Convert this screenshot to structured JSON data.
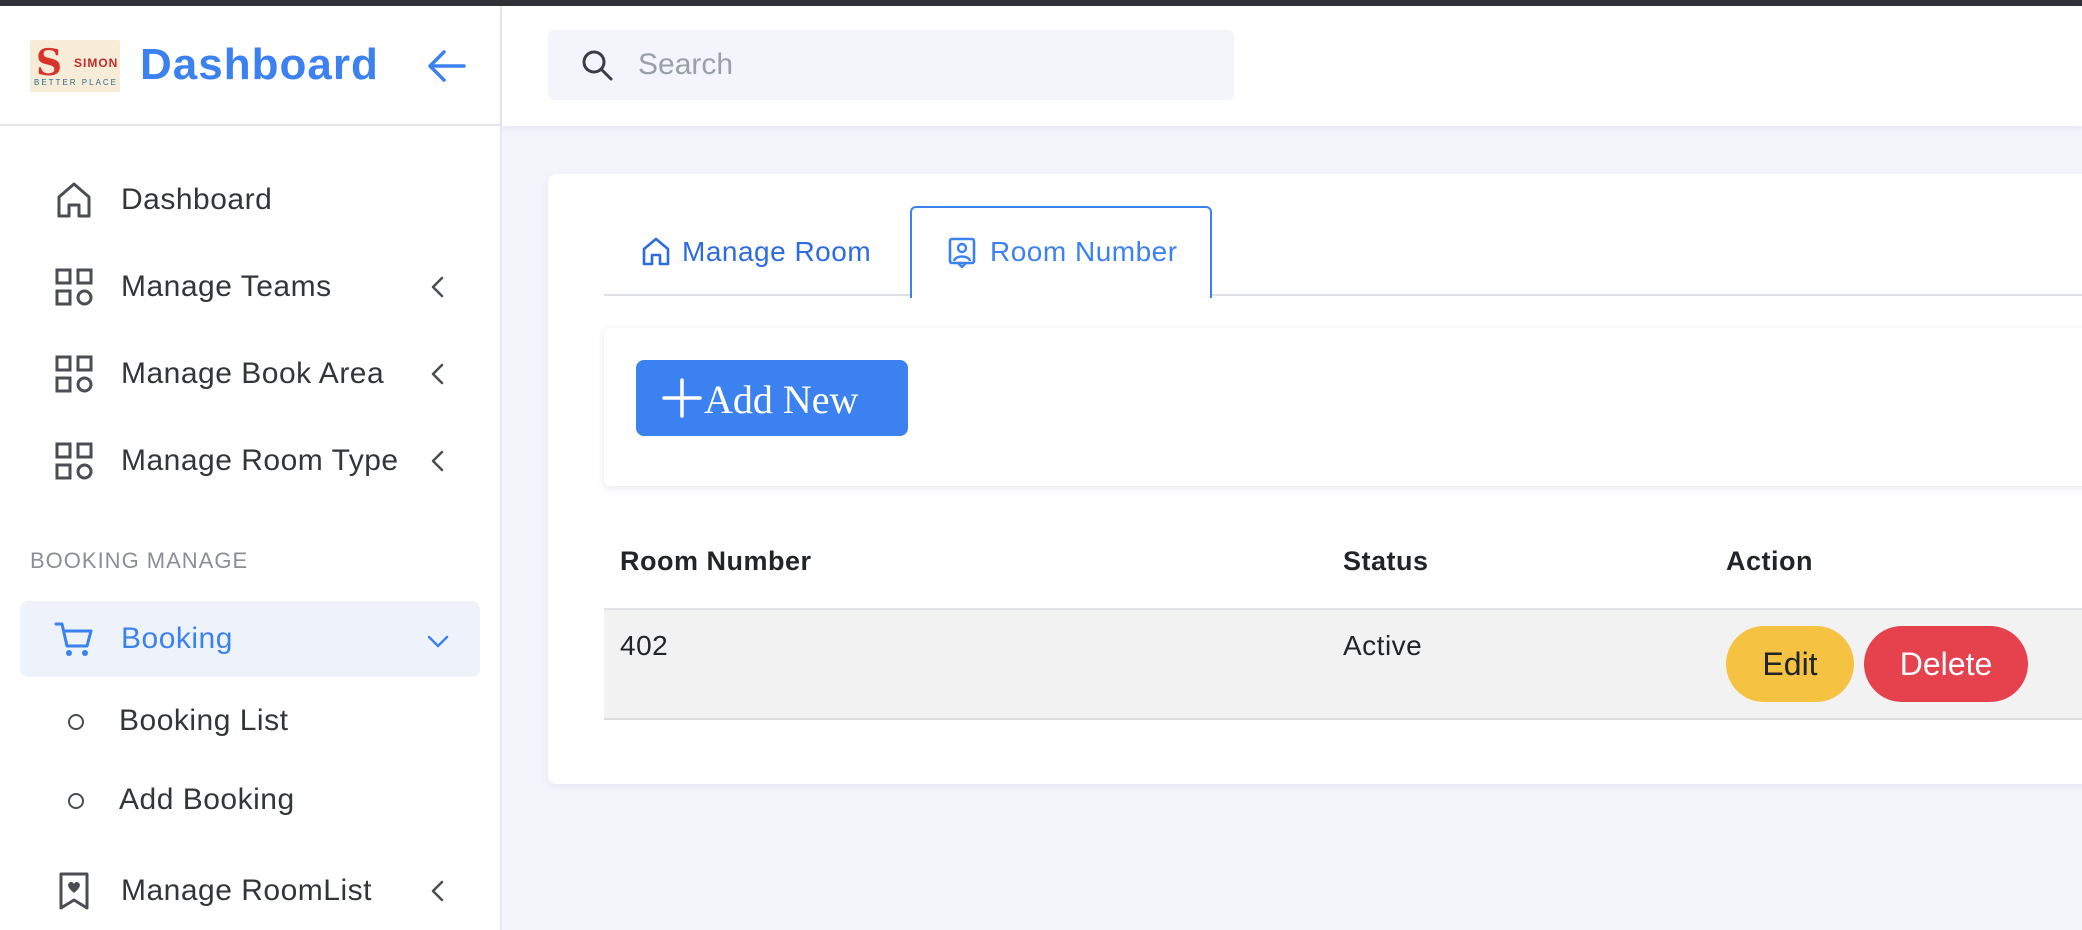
{
  "brand": {
    "logo_mark": "S",
    "logo_text": "SIMON",
    "logo_sub": "BETTER PLACE",
    "title": "Dashboard"
  },
  "sidebar": {
    "items": [
      {
        "label": "Dashboard",
        "icon": "home-icon"
      },
      {
        "label": "Manage Teams",
        "icon": "grid-icon"
      },
      {
        "label": "Manage Book Area",
        "icon": "grid-icon"
      },
      {
        "label": "Manage Room Type",
        "icon": "grid-icon"
      }
    ],
    "section_title": "BOOKING MANAGE",
    "booking": {
      "label": "Booking",
      "icon": "cart-icon",
      "expanded": true
    },
    "booking_sub": [
      {
        "label": "Booking List"
      },
      {
        "label": "Add Booking"
      }
    ],
    "roomlist": {
      "label": "Manage RoomList",
      "icon": "bookmark-heart-icon"
    }
  },
  "search": {
    "placeholder": "Search",
    "value": ""
  },
  "tabs": [
    {
      "label": "Manage Room",
      "icon": "home-icon",
      "active": false
    },
    {
      "label": "Room Number",
      "icon": "person-square-icon",
      "active": true
    }
  ],
  "add_button": {
    "label": "Add New"
  },
  "table": {
    "headers": [
      "Room Number",
      "Status",
      "Action"
    ],
    "rows": [
      {
        "room_number": "402",
        "status": "Active",
        "edit_label": "Edit",
        "delete_label": "Delete"
      }
    ]
  },
  "colors": {
    "accent": "#3b82f0",
    "edit": "#f5c242",
    "delete": "#e5424e",
    "background": "#f4f4fb"
  }
}
